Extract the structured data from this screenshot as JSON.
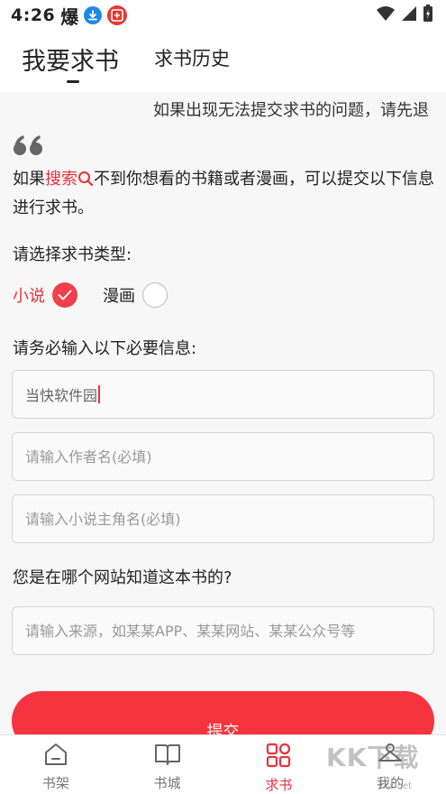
{
  "status": {
    "time": "4:26",
    "bao_icon": "爆"
  },
  "header": {
    "tab_main": "我要求书",
    "tab_history": "求书历史"
  },
  "notice": "如果出现无法提交求书的问题，请先退",
  "intro": {
    "prefix": "如果",
    "highlight": "搜索",
    "suffix": "不到你想看的书籍或者漫画，可以提交以下信息进行求书。"
  },
  "type_section": {
    "label": "请选择求书类型:",
    "options": [
      {
        "label": "小说",
        "selected": true
      },
      {
        "label": "漫画",
        "selected": false
      }
    ]
  },
  "required_section": {
    "label": "请务必输入以下必要信息:",
    "book_name_value": "当快软件园",
    "author_placeholder": "请输入作者名(必填)",
    "protagonist_placeholder": "请输入小说主角名(必填)"
  },
  "source_section": {
    "label": "您是在哪个网站知道这本书的?",
    "placeholder": "请输入来源，如某某APP、某某网站、某某公众号等"
  },
  "submit_label": "提交",
  "bottom_nav": {
    "bookshelf": "书架",
    "bookstore": "书城",
    "request": "求书",
    "mine": "我的"
  },
  "watermark": {
    "main": "KK下载",
    "sub": "kkx.net"
  },
  "colors": {
    "accent": "#f5343f",
    "text": "#222222",
    "placeholder": "#999999"
  }
}
